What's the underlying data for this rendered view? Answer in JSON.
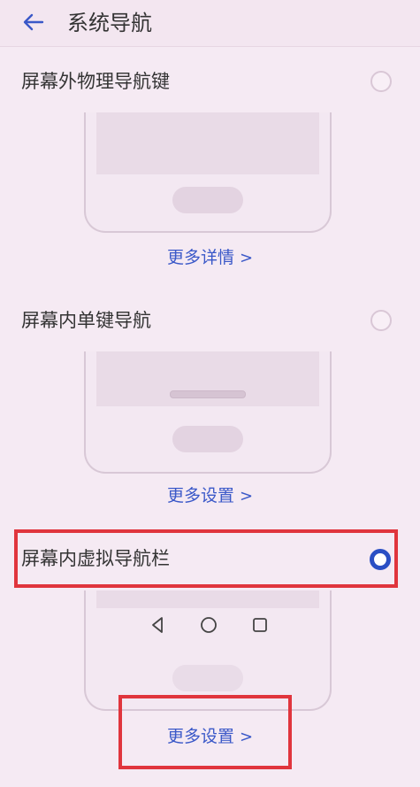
{
  "header": {
    "title": "系统导航"
  },
  "options": [
    {
      "label": "屏幕外物理导航键",
      "link": "更多详情",
      "selected": false
    },
    {
      "label": "屏幕内单键导航",
      "link": "更多设置",
      "selected": false
    },
    {
      "label": "屏幕内虚拟导航栏",
      "link": "更多设置",
      "selected": true
    }
  ],
  "icons": {
    "back": "arrow-left-icon",
    "chevron": "chevron-right-icon",
    "nav_back": "triangle-back-icon",
    "nav_home": "circle-home-icon",
    "nav_recent": "square-recent-icon"
  },
  "colors": {
    "accent": "#2a4fc4",
    "link": "#3a58c8",
    "highlight": "#e0353d",
    "background": "#f5eaf3"
  }
}
